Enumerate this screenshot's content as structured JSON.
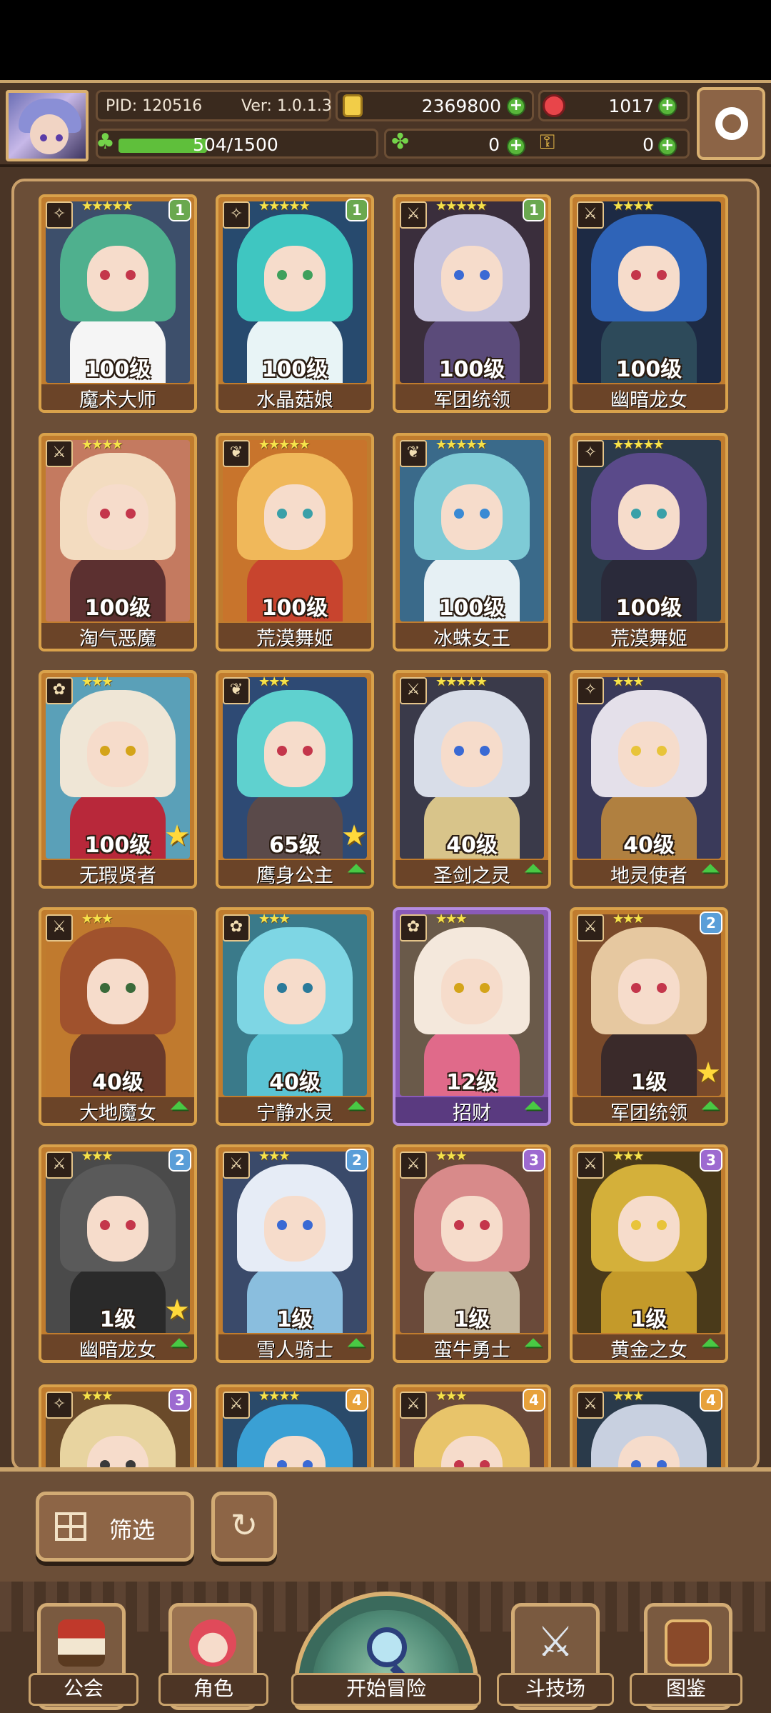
{
  "header": {
    "pid": "PID: 120516",
    "version": "Ver: 1.0.1.3",
    "gold": "2369800",
    "gems": "1017",
    "exp": "504/1500",
    "exp_fraction": 0.336,
    "clover": "0",
    "keys": "0"
  },
  "cards": [
    {
      "level": "100级",
      "name": "魔术大师",
      "stars": "★★★★★",
      "tier": "1",
      "tier_color": "green",
      "type": "wand-icon",
      "hair": "#4fb08e",
      "body": "#f5f5f5",
      "eye": "#c4364b",
      "bg": "#3d4f6b",
      "upgrade": false,
      "star": false
    },
    {
      "level": "100级",
      "name": "水晶菇娘",
      "stars": "★★★★★",
      "tier": "1",
      "tier_color": "green",
      "type": "wand-icon",
      "hair": "#3fc6c1",
      "body": "#e8f4f6",
      "eye": "#3fa05c",
      "bg": "#274a6e",
      "upgrade": false,
      "star": false
    },
    {
      "level": "100级",
      "name": "军团统领",
      "stars": "★★★★★",
      "tier": "1",
      "tier_color": "green",
      "type": "sword-icon",
      "hair": "#c6c3dd",
      "body": "#5b4b7a",
      "eye": "#3a6ad4",
      "bg": "#3a2e3c",
      "upgrade": false,
      "star": false
    },
    {
      "level": "100级",
      "name": "幽暗龙女",
      "stars": "★★★★",
      "tier": "",
      "tier_color": "",
      "type": "sword-icon",
      "hair": "#2f64b8",
      "body": "#2d4a5a",
      "eye": "#c4364b",
      "bg": "#1d2a44",
      "upgrade": false,
      "star": false
    },
    {
      "level": "100级",
      "name": "淘气恶魔",
      "stars": "★★★★",
      "tier": "",
      "tier_color": "",
      "type": "sword-icon",
      "hair": "#f3dcc0",
      "body": "#5c3030",
      "eye": "#c4364b",
      "bg": "#c47a60",
      "upgrade": false,
      "star": false
    },
    {
      "level": "100级",
      "name": "荒漠舞姬",
      "stars": "★★★★★",
      "tier": "",
      "tier_color": "",
      "type": "leaf-icon",
      "hair": "#f0b85a",
      "body": "#c8442e",
      "eye": "#3aa0a8",
      "bg": "#c8742c",
      "upgrade": false,
      "star": false
    },
    {
      "level": "100级",
      "name": "冰蛛女王",
      "stars": "★★★★★",
      "tier": "",
      "tier_color": "",
      "type": "leaf-icon",
      "hair": "#7ecbd6",
      "body": "#e6f0f4",
      "eye": "#3a8ad4",
      "bg": "#3a6a8a",
      "upgrade": false,
      "star": false
    },
    {
      "level": "100级",
      "name": "荒漠舞姬",
      "stars": "★★★★★",
      "tier": "",
      "tier_color": "",
      "type": "wand-icon",
      "hair": "#5a4a8a",
      "body": "#2a2a3a",
      "eye": "#3aa0a8",
      "bg": "#2b3a4a",
      "upgrade": false,
      "star": false
    },
    {
      "level": "100级",
      "name": "无瑕贤者",
      "stars": "★★★",
      "tier": "",
      "tier_color": "",
      "type": "flower-icon",
      "hair": "#efe6d6",
      "body": "#b8283a",
      "eye": "#d4a41a",
      "bg": "#5aa0b8",
      "upgrade": false,
      "star": true
    },
    {
      "level": "65级",
      "name": "鹰身公主",
      "stars": "★★★",
      "tier": "",
      "tier_color": "",
      "type": "leaf-icon",
      "hair": "#5fd1cf",
      "body": "#5a4a4a",
      "eye": "#c4364b",
      "bg": "#2e4a74",
      "upgrade": true,
      "star": true
    },
    {
      "level": "40级",
      "name": "圣剑之灵",
      "stars": "★★★★★",
      "tier": "",
      "tier_color": "",
      "type": "sword-icon",
      "hair": "#d8dde8",
      "body": "#d8c48a",
      "eye": "#3a6ad4",
      "bg": "#3a3a4a",
      "upgrade": true,
      "star": false
    },
    {
      "level": "40级",
      "name": "地灵使者",
      "stars": "★★★",
      "tier": "",
      "tier_color": "",
      "type": "wand-icon",
      "hair": "#e4e0ea",
      "body": "#b08040",
      "eye": "#e8c43a",
      "bg": "#3a3a5a",
      "upgrade": true,
      "star": false
    },
    {
      "level": "40级",
      "name": "大地魔女",
      "stars": "★★★",
      "tier": "",
      "tier_color": "",
      "type": "sword-icon",
      "hair": "#a0522d",
      "body": "#6a3a2a",
      "eye": "#3a6a3a",
      "bg": "#c07a2e",
      "upgrade": true,
      "star": false
    },
    {
      "level": "40级",
      "name": "宁静水灵",
      "stars": "★★★",
      "tier": "",
      "tier_color": "",
      "type": "flower-icon",
      "hair": "#7ed6e4",
      "body": "#5ac4d4",
      "eye": "#2a7a9a",
      "bg": "#3a7a8a",
      "upgrade": true,
      "star": false
    },
    {
      "level": "12级",
      "name": "招财",
      "stars": "★★★",
      "tier": "",
      "tier_color": "",
      "type": "flower-icon",
      "hair": "#f4e8dc",
      "body": "#e06a8a",
      "eye": "#d4a41a",
      "bg": "#6a5a4a",
      "upgrade": true,
      "star": false,
      "purple": true
    },
    {
      "level": "1级",
      "name": "军团统领",
      "stars": "★★★",
      "tier": "2",
      "tier_color": "blue",
      "type": "sword-icon",
      "hair": "#e6c8a0",
      "body": "#3a2a2a",
      "eye": "#c4364b",
      "bg": "#7a4a2a",
      "upgrade": true,
      "star": true
    },
    {
      "level": "1级",
      "name": "幽暗龙女",
      "stars": "★★★",
      "tier": "2",
      "tier_color": "blue",
      "type": "sword-icon",
      "hair": "#5a5a5a",
      "body": "#2a2a2a",
      "eye": "#c4364b",
      "bg": "#4a4a4a",
      "upgrade": true,
      "star": true
    },
    {
      "level": "1级",
      "name": "雪人骑士",
      "stars": "★★★",
      "tier": "2",
      "tier_color": "blue",
      "type": "sword-icon",
      "hair": "#e6ecf6",
      "body": "#8abede",
      "eye": "#3a6ad4",
      "bg": "#3a4a6a",
      "upgrade": true,
      "star": false
    },
    {
      "level": "1级",
      "name": "蛮牛勇士",
      "stars": "★★★",
      "tier": "3",
      "tier_color": "purple",
      "type": "sword-icon",
      "hair": "#d88a8a",
      "body": "#c4b8a0",
      "eye": "#c4364b",
      "bg": "#6a4a3a",
      "upgrade": true,
      "star": false
    },
    {
      "level": "1级",
      "name": "黄金之女",
      "stars": "★★★",
      "tier": "3",
      "tier_color": "purple",
      "type": "sword-icon",
      "hair": "#d4b03a",
      "body": "#c49a2a",
      "eye": "#e8c43a",
      "bg": "#4a3a1a",
      "upgrade": true,
      "star": false
    },
    {
      "level": "",
      "name": "",
      "stars": "★★★",
      "tier": "3",
      "tier_color": "purple",
      "type": "wand-icon",
      "hair": "#e8d4a0",
      "body": "#c4a470",
      "eye": "#3a3a3a",
      "bg": "#6a4a2a",
      "upgrade": false,
      "star": false
    },
    {
      "level": "",
      "name": "",
      "stars": "★★★★",
      "tier": "4",
      "tier_color": "orange",
      "type": "sword-icon",
      "hair": "#3aa0d4",
      "body": "#3a6a8a",
      "eye": "#3a6ad4",
      "bg": "#2a4a6a",
      "upgrade": false,
      "star": false
    },
    {
      "level": "",
      "name": "",
      "stars": "★★★",
      "tier": "4",
      "tier_color": "orange",
      "type": "sword-icon",
      "hair": "#e8c46a",
      "body": "#c49a4a",
      "eye": "#c4364b",
      "bg": "#6a4a3a",
      "upgrade": false,
      "star": false
    },
    {
      "level": "",
      "name": "",
      "stars": "★★★",
      "tier": "4",
      "tier_color": "orange",
      "type": "sword-icon",
      "hair": "#c8d0e0",
      "body": "#8a90a0",
      "eye": "#3a6ad4",
      "bg": "#2a3a4a",
      "upgrade": false,
      "star": false
    }
  ],
  "controls": {
    "filter_label": "筛选",
    "reset_icon": "refresh-icon"
  },
  "nav": {
    "guild": "公会",
    "character": "角色",
    "adventure": "开始冒险",
    "arena": "斗技场",
    "codex": "图鉴"
  }
}
